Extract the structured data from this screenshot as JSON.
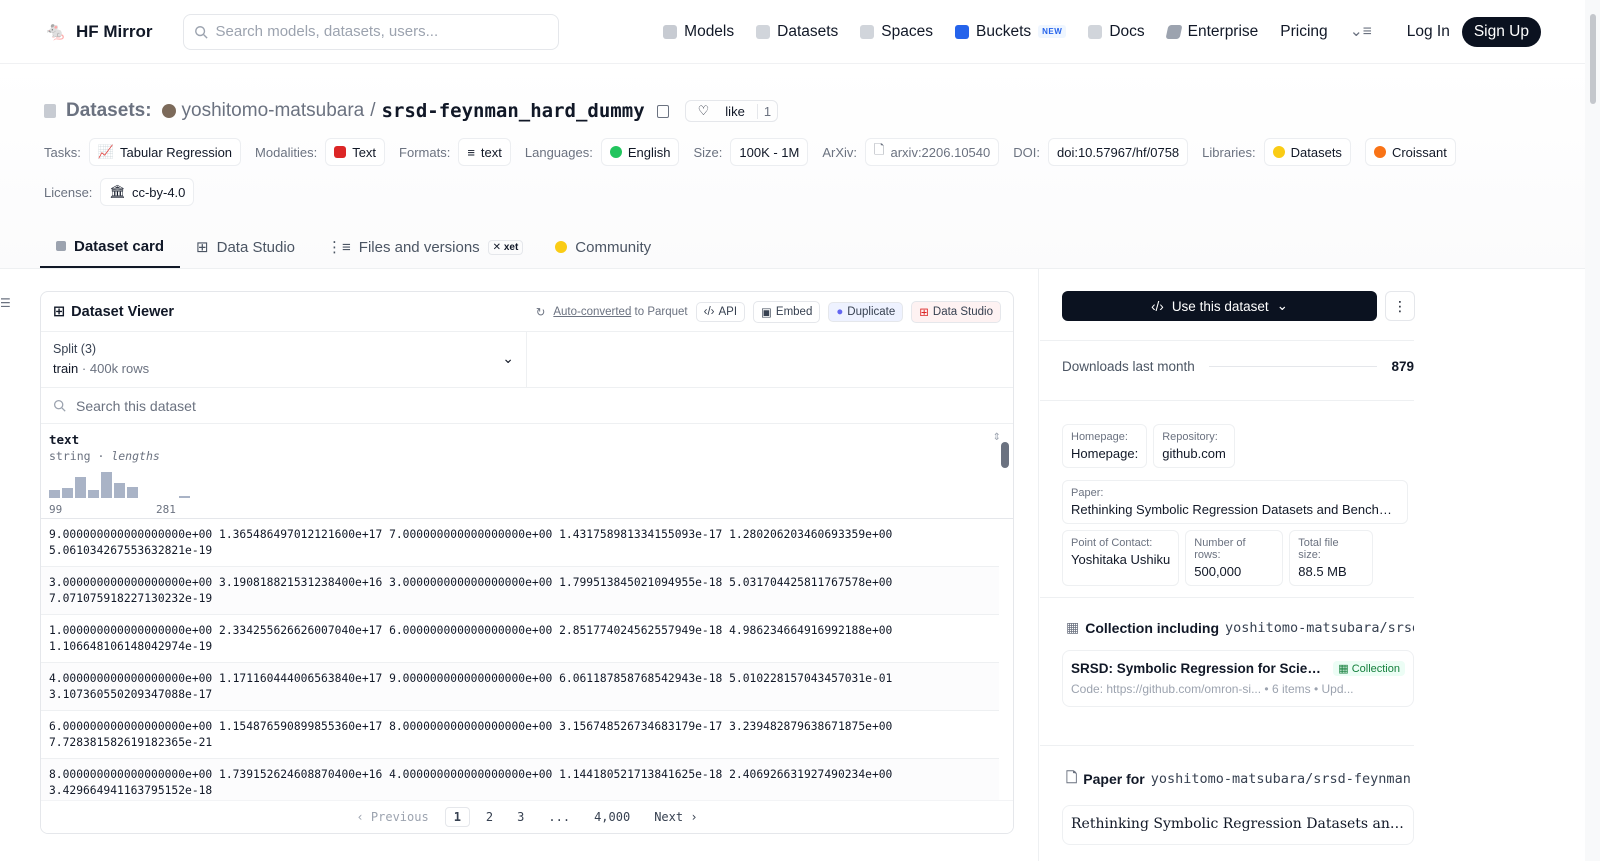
{
  "header": {
    "brand": "HF Mirror",
    "search_placeholder": "Search models, datasets, users...",
    "nav": [
      {
        "label": "Models",
        "icon": "cube-icon",
        "color": "#9ca3af"
      },
      {
        "label": "Datasets",
        "icon": "database-icon",
        "color": "#9ca3af"
      },
      {
        "label": "Spaces",
        "icon": "grid-icon",
        "color": "#9ca3af"
      },
      {
        "label": "Buckets",
        "icon": "bucket-icon",
        "color": "#2563eb"
      },
      {
        "label": "Docs",
        "icon": "book-icon",
        "color": "#9ca3af"
      },
      {
        "label": "Enterprise",
        "icon": "enterprise-icon",
        "color": "#6b7280"
      },
      {
        "label": "Pricing"
      }
    ],
    "new_badge": "NEW",
    "login": "Log In",
    "signup": "Sign Up"
  },
  "title": {
    "section": "Datasets:",
    "owner": "yoshitomo-matsubara",
    "sep": "/",
    "name": "srsd-feynman_hard_dummy",
    "like_label": "like",
    "like_count": "1"
  },
  "tags": {
    "tasks_label": "Tasks:",
    "task": "Tabular Regression",
    "modalities_label": "Modalities:",
    "modality": "Text",
    "formats_label": "Formats:",
    "format": "text",
    "languages_label": "Languages:",
    "language": "English",
    "size_label": "Size:",
    "size": "100K - 1M",
    "arxiv_label": "ArXiv:",
    "arxiv": "arxiv:2206.10540",
    "doi_label": "DOI:",
    "doi": "doi:10.57967/hf/0758",
    "libraries_label": "Libraries:",
    "lib1": "Datasets",
    "lib2": "Croissant",
    "license_label": "License:",
    "license": "cc-by-4.0"
  },
  "tabs": [
    {
      "label": "Dataset card",
      "active": true
    },
    {
      "label": "Data Studio"
    },
    {
      "label": "Files and versions",
      "badge": "xet"
    },
    {
      "label": "Community"
    }
  ],
  "viewer": {
    "title": "Dataset Viewer",
    "auto_converted": "Auto-converted",
    "to_parquet": "to Parquet",
    "api": "API",
    "embed": "Embed",
    "duplicate": "Duplicate",
    "data_studio": "Data Studio",
    "split_label": "Split (3)",
    "split_name": "train",
    "split_rows": "400k rows",
    "search_placeholder": "Search this dataset",
    "column": {
      "name": "text",
      "type": "string",
      "stat": "lengths",
      "min": "99",
      "max": "281"
    },
    "histogram": [
      0.28,
      0.36,
      0.74,
      0.28,
      0.92,
      0.52,
      0.38,
      0,
      0,
      0,
      0.06
    ],
    "rows": [
      "9.000000000000000000e+00 1.365486497012121600e+17 7.000000000000000000e+00 1.431758981334155093e-17 1.280206203460693359e+00\n5.061034267553632821e-19",
      "3.000000000000000000e+00 3.190818821531238400e+16 3.000000000000000000e+00 1.799513845021094955e-18 5.031704425811767578e+00\n7.071075918227130232e-19",
      "1.000000000000000000e+00 2.334255626626007040e+17 6.000000000000000000e+00 2.851774024562557949e-18 4.986234664916992188e+00\n1.106648106148042974e-19",
      "4.000000000000000000e+00 1.171160444006563840e+17 9.000000000000000000e+00 6.061187858768542943e-18 5.010228157043457031e-01\n3.107360550209347088e-17",
      "6.000000000000000000e+00 1.154876590899855360e+17 8.000000000000000000e+00 3.156748526734683179e-17 3.239482879638671875e+00\n7.728381582619182365e-21",
      "8.000000000000000000e+00 1.739152624608870400e+16 4.000000000000000000e+00 1.144180521713841625e-18 2.406926631927490234e+00\n3.429664941163795152e-18"
    ],
    "pager": {
      "prev": "Previous",
      "p1": "1",
      "p2": "2",
      "p3": "3",
      "dots": "...",
      "last": "4,000",
      "next": "Next"
    }
  },
  "sidebar": {
    "use_dataset": "Use this dataset",
    "downloads_label": "Downloads last month",
    "downloads": "879",
    "meta": [
      {
        "k": "Homepage:",
        "v": "Homepage:"
      },
      {
        "k": "Repository:",
        "v": "github.com"
      },
      {
        "k": "Paper:",
        "v": "Rethinking Symbolic Regression Datasets and Benchm..."
      },
      {
        "k": "Point of Contact:",
        "v": "Yoshitaka Ushiku"
      },
      {
        "k": "Number of rows:",
        "v": "500,000"
      },
      {
        "k": "Total file size:",
        "v": "88.5 MB"
      }
    ],
    "collection_title": "Collection including",
    "collection_repo": "yoshitomo-matsubara/srsd...",
    "collection_name": "SRSD: Symbolic Regression for Scient...",
    "collection_badge": "Collection",
    "collection_sub": "Code: https://github.com/omron-si...  • 6 items  • Upd...",
    "paper_title": "Paper for",
    "paper_repo": "yoshitomo-matsubara/srsd-feynman...",
    "paper_name": "Rethinking Symbolic Regression Datasets and Ben..."
  }
}
